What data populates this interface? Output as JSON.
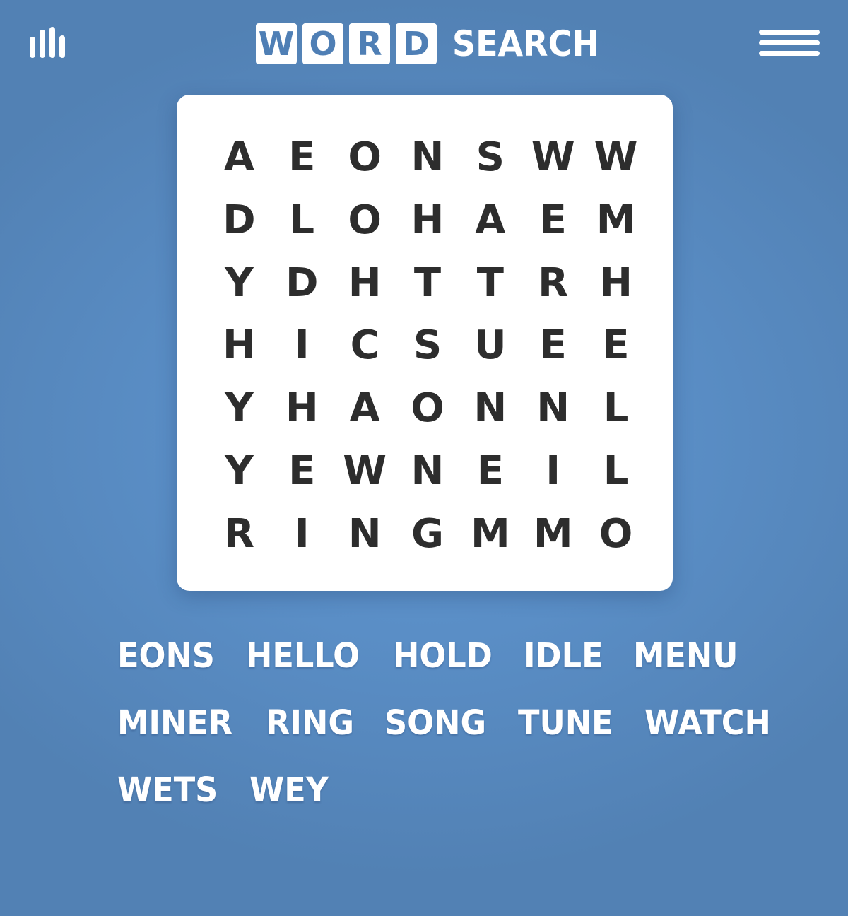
{
  "header": {
    "logo_tiles": [
      "W",
      "O",
      "R",
      "D"
    ],
    "logo_rest": "SEARCH",
    "stats_icon": "bar-chart-icon",
    "menu_icon": "hamburger-menu-icon"
  },
  "board": {
    "rows": [
      [
        "A",
        "E",
        "O",
        "N",
        "S",
        "W",
        "W"
      ],
      [
        "D",
        "L",
        "O",
        "H",
        "A",
        "E",
        "M"
      ],
      [
        "Y",
        "D",
        "H",
        "T",
        "T",
        "R",
        "H"
      ],
      [
        "H",
        "I",
        "C",
        "S",
        "U",
        "E",
        "E"
      ],
      [
        "Y",
        "H",
        "A",
        "O",
        "N",
        "N",
        "L"
      ],
      [
        "Y",
        "E",
        "W",
        "N",
        "E",
        "I",
        "L"
      ],
      [
        "R",
        "I",
        "N",
        "G",
        "M",
        "M",
        "O"
      ]
    ]
  },
  "words": {
    "rows": [
      [
        "EONS",
        "HELLO",
        "HOLD",
        "IDLE",
        "MENU"
      ],
      [
        "MINER",
        "RING",
        "SONG",
        "TUNE",
        "WATCH"
      ],
      [
        "WETS",
        "WEY"
      ]
    ]
  },
  "colors": {
    "background": "#5a8ec6",
    "tile_text": "#4f7fb5",
    "letter": "#2d2d2d",
    "board": "#ffffff"
  }
}
